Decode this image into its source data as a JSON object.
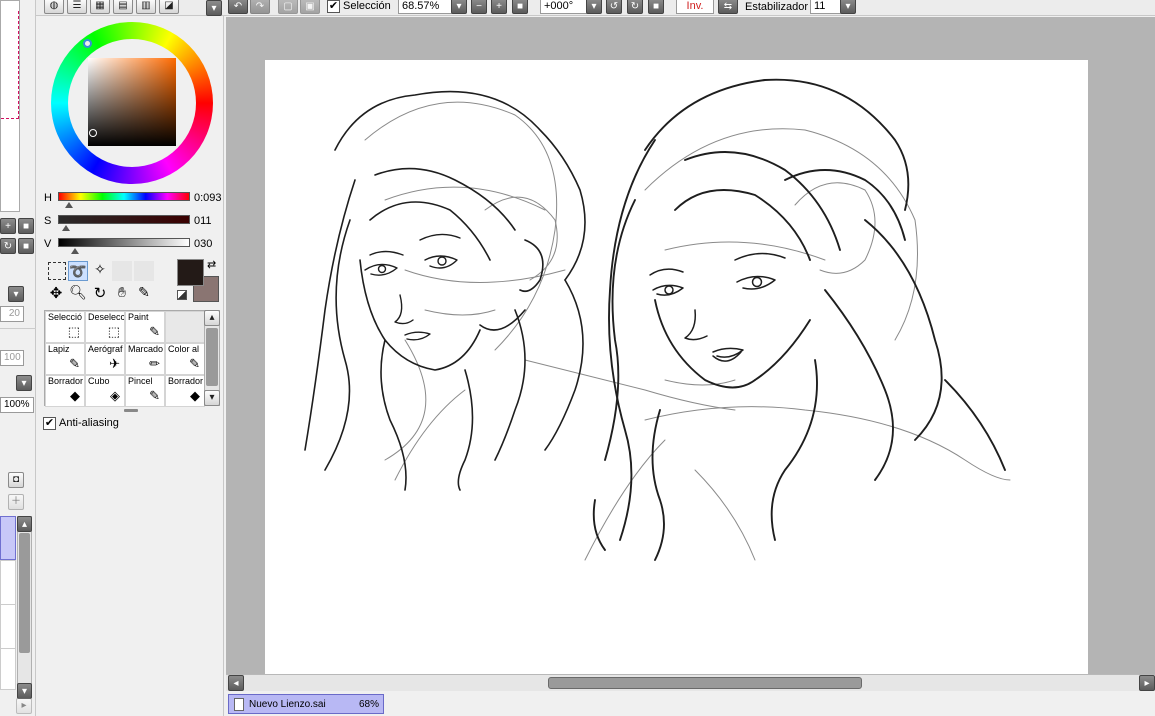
{
  "toolbar": {
    "selection_label": "Selección",
    "zoom_value": "68.57%",
    "rotation_value": "+000°",
    "invert_label": "Inv.",
    "stabilizer_label": "Estabilizador",
    "stabilizer_value": "11"
  },
  "color_panel": {
    "h_label": "H",
    "h_value": "0:093",
    "s_label": "S",
    "s_value": "011",
    "v_label": "V",
    "v_value": "030",
    "primary_color": "#231a17",
    "secondary_color": "#8a7572"
  },
  "left_strip": {
    "value_20": "20",
    "value_100": "100",
    "value_pct": "100%"
  },
  "tools": [
    {
      "label": "Selecció",
      "icon": "select-icon"
    },
    {
      "label": "Deselecc",
      "icon": "deselect-icon"
    },
    {
      "label": "Paint",
      "icon": "paint-icon"
    },
    {
      "label": "",
      "icon": ""
    },
    {
      "label": "Lapiz",
      "icon": "pencil-icon"
    },
    {
      "label": "Aerógraf",
      "icon": "airbrush-icon"
    },
    {
      "label": "Marcado",
      "icon": "marker-icon"
    },
    {
      "label": "Color al",
      "icon": "watercolor-icon"
    },
    {
      "label": "Borrador",
      "icon": "eraser-icon"
    },
    {
      "label": "Cubo",
      "icon": "bucket-icon"
    },
    {
      "label": "Pincel",
      "icon": "brush-icon"
    },
    {
      "label": "Borrador",
      "icon": "eraser-icon"
    }
  ],
  "antialiasing_label": "Anti-aliasing",
  "document_tab": {
    "name": "Nuevo Lienzo.sai",
    "zoom": "68%"
  },
  "colors": {
    "canvas_bg": "#b4b4b4",
    "tab_bg": "#b8b8f4",
    "invert_text": "#d02020"
  }
}
